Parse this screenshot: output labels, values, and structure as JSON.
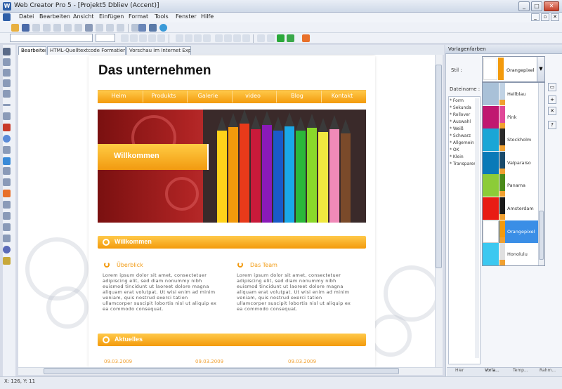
{
  "window": {
    "title": "Web Creator Pro 5 - [Projekt5 Dbliev (Accent)]",
    "minimize": "_",
    "maximize": "□",
    "close": "✕"
  },
  "menu": {
    "items": [
      "Datei",
      "Bearbeiten",
      "Ansicht",
      "Einfügen",
      "Format",
      "Tools",
      "Fenster",
      "Hilfe"
    ]
  },
  "tabs": [
    {
      "label": "Bearbeiten",
      "active": true
    },
    {
      "label": "HTML-Quelltextcode Formatierung",
      "active": false
    },
    {
      "label": "Vorschau im Internet Explorer",
      "active": false
    }
  ],
  "site": {
    "title": "Das unternehmen",
    "nav": [
      "Heim",
      "Produkts",
      "Galerie",
      "video",
      "Blog",
      "Kontakt"
    ],
    "hero_label": "Willkommen",
    "section1": "Willkommen",
    "col1_title": "Überblick",
    "col2_title": "Das Team",
    "lorem1": "Lorem ipsum dolor sit amet, consectetuer adipiscing elit, sed diam nonummy nibh euismod tincidunt ut laoreet dolore magna aliquam erat volutpat. Ut wisi enim ad minim veniam, quis nostrud exerci tation ullamcorper suscipit lobortis nisl ut aliquip ex ea commodo consequat.",
    "lorem2": "Lorem ipsum dolor sit amet, consectetuer adipiscing elit, sed diam nonummy nibh euismod tincidunt ut laoreet dolore magna aliquam erat volutpat. Ut wisi enim ad minim veniam, quis nostrud exerci tation ullamcorper suscipit lobortis nisl ut aliquip ex ea commodo consequat.",
    "section2": "Aktuelles",
    "dates": [
      "09.03.2009",
      "09.03.2009",
      "09.03.2009"
    ]
  },
  "panel": {
    "title": "Vorlagenfarben",
    "stil_label": "Stil :",
    "stil_value": "Orangepixel",
    "dateiname_label": "Dateiname :",
    "ul_items": [
      "* Form",
      "* Sekunda",
      "* Rollover",
      "* Auswahl",
      "* Weiß",
      "* Schwarz",
      "* Allgemein",
      "* OK",
      "* Klein",
      "* Transparent"
    ],
    "swatches": [
      {
        "name": "Hellblau",
        "main": "#a9c1d8",
        "small1": "#c0d2e4",
        "small2": "#f0a030",
        "selected": false
      },
      {
        "name": "Pink",
        "main": "#c01870",
        "small1": "#e04898",
        "small2": "#f0a030",
        "selected": false
      },
      {
        "name": "Stockholm",
        "main": "#1aa6d6",
        "small1": "#2a2a2a",
        "small2": "#f0a030",
        "selected": false
      },
      {
        "name": "Valparaiso",
        "main": "#0a7ab8",
        "small1": "#1a4a6a",
        "small2": "#f0a030",
        "selected": false
      },
      {
        "name": "Panama",
        "main": "#8ccc38",
        "small1": "#4a8a1a",
        "small2": "#f0a030",
        "selected": false
      },
      {
        "name": "Amsterdam",
        "main": "#e81c14",
        "small1": "#1a1a1a",
        "small2": "#f0a030",
        "selected": false
      },
      {
        "name": "Orangepixel",
        "main": "#ffffff",
        "small1": "#f39a0c",
        "small2": "#f0a030",
        "selected": true
      },
      {
        "name": "Honolulu",
        "main": "#3cc8f0",
        "small1": "#e0e0e0",
        "small2": "#f0a030",
        "selected": false
      }
    ],
    "bottom_tabs": [
      "Hier",
      "Vorla...",
      "Temp...",
      "Rahm..."
    ]
  },
  "status": {
    "text": "X: 126, Y: 11"
  },
  "colors": {
    "accent_orange": "#f39a0c",
    "selection_blue": "#3a8ee6"
  }
}
